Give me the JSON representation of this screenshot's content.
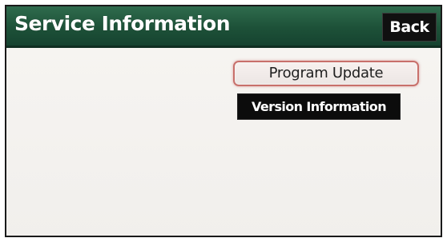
{
  "header": {
    "title": "Service Information",
    "back_label": "Back"
  },
  "menu": {
    "items": [
      {
        "label": "Program Update",
        "state": "selected"
      },
      {
        "label": "Version Information",
        "state": "normal"
      }
    ]
  },
  "colors": {
    "header_green": "#1d5138",
    "button_black": "#0c0c0c",
    "selected_outline": "#c8706b",
    "content_background": "#f3f1ee"
  }
}
